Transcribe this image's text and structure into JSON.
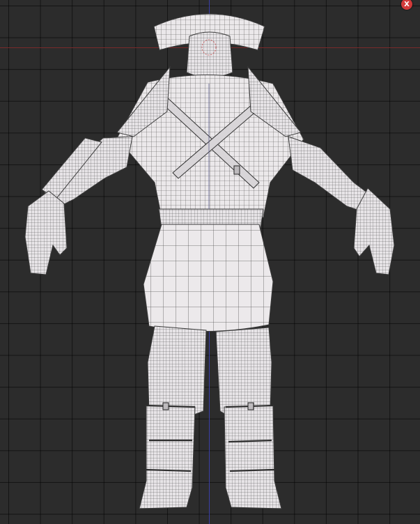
{
  "viewport": {
    "close_label": "X",
    "background_color": "#2c2c2c",
    "grid_color": "#000000",
    "x_axis_color": "#7a2b2b",
    "y_axis_color": "#3a3fa8",
    "mesh_fill": "#e8e5e8",
    "mesh_wire": "#4a4a4a"
  }
}
